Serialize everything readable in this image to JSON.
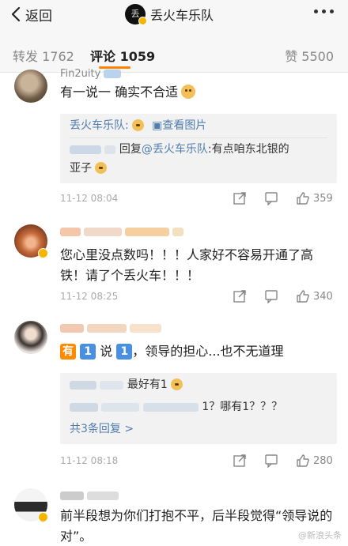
{
  "header": {
    "back_label": "返回",
    "title": "丢火车乐队"
  },
  "tabs": {
    "repost": "转发 1762",
    "comment": "评论 1059",
    "like": "赞 5500"
  },
  "comments": [
    {
      "username": "Fin2uity",
      "text": "有一说一 确实不合适",
      "quote": {
        "head_name": "丢火车乐队:",
        "view_image": "查看图片",
        "reply_prefix": "回复",
        "reply_mention": "@丢火车乐队",
        "reply_text": ":有点咱东北银的",
        "reply_text_2": "亚子"
      },
      "time": "11-12 08:04",
      "likes": "359"
    },
    {
      "text": "您心里没点数吗！！！人家好不容易开通了高铁！请了个丢火车！！！",
      "time": "11-12 08:25",
      "likes": "340"
    },
    {
      "text_has": "有",
      "text_n1": "1",
      "text_say": "说",
      "text_n2": "1",
      "text_rest": "，领导的担心...也不无道理",
      "quote": {
        "reply1": "最好有1",
        "reply2": "1？哪有1？？？",
        "more": "共3条回复 >"
      },
      "time": "11-12 08:18",
      "likes": "280"
    },
    {
      "text": "前半段想为你们打抱不平，后半段觉得“领导说的对”。"
    }
  ],
  "watermark": "@新浪头条",
  "colors": {
    "accent": "#ff8200",
    "link": "#507daf",
    "badge": "#f7b500"
  }
}
